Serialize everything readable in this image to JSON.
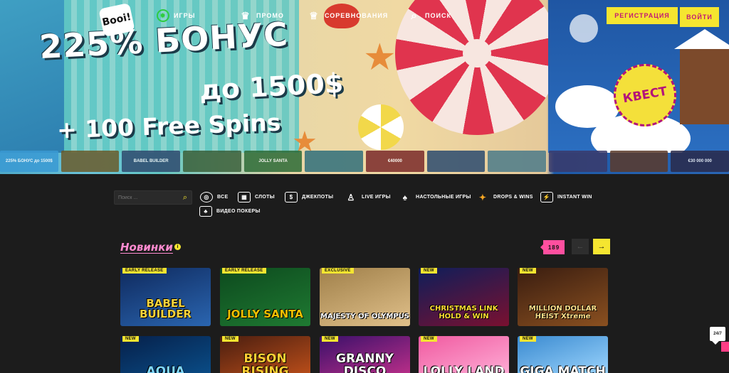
{
  "nav": {
    "logo_text": "Booi!",
    "items": [
      {
        "label": "ИГРЫ",
        "icon": "slots-coin-icon"
      },
      {
        "label": "ПРОМО",
        "icon": "crown-icon"
      },
      {
        "label": "СОРЕВНОВАНИЯ",
        "icon": "trophy-icon"
      },
      {
        "label": "ПОИСК",
        "icon": "search-icon"
      }
    ],
    "register_label": "РЕГИСТРАЦИЯ",
    "login_label": "ВОЙТИ"
  },
  "hero": {
    "line1": "225% БОНУС",
    "line2": "до 1500$",
    "line3": "+ 100 Free Spins",
    "quest_badge": "КВЕСТ"
  },
  "strip": [
    {
      "label": "225% БОНУС до 1500$",
      "color": "#3a9ad4"
    },
    {
      "label": "",
      "color": "#6a5a2a"
    },
    {
      "label": "BABEL BUILDER",
      "color": "#2f4a6e"
    },
    {
      "label": "",
      "color": "#3a5f3a"
    },
    {
      "label": "JOLLY SANTA",
      "color": "#2d6b37"
    },
    {
      "label": "",
      "color": "#2f6e7a"
    },
    {
      "label": "€40000",
      "color": "#7a2a2a"
    },
    {
      "label": "",
      "color": "#2a4a6e"
    },
    {
      "label": "",
      "color": "#4a7a8a"
    },
    {
      "label": "",
      "color": "#3a3a6a"
    },
    {
      "label": "",
      "color": "#5a3a2a"
    },
    {
      "label": "€30 000 000",
      "color": "#2a2a4a"
    }
  ],
  "filters": {
    "search_placeholder": "Поиск ...",
    "categories": [
      {
        "label": "ВСЕ",
        "icon": "all-games-icon"
      },
      {
        "label": "СЛОТЫ",
        "icon": "slot-machine-icon"
      },
      {
        "label": "ДЖЕКПОТЫ",
        "icon": "jackpot-icon"
      },
      {
        "label": "LIVE ИГРЫ",
        "icon": "live-dealer-icon"
      },
      {
        "label": "НАСТОЛЬНЫЕ ИГРЫ",
        "icon": "table-games-icon"
      },
      {
        "label": "DROPS & WINS",
        "icon": "drops-wins-icon"
      },
      {
        "label": "INSTANT WIN",
        "icon": "instant-win-icon"
      },
      {
        "label": "ВИДЕО ПОКЕРЫ",
        "icon": "video-poker-icon"
      }
    ]
  },
  "section": {
    "title": "Новинки",
    "info": "i",
    "count": "189",
    "prev": "←",
    "next": "→"
  },
  "games": [
    {
      "badge": "EARLY RELEASE",
      "name": "BABEL BUILDER",
      "color1": "#0f2a5e",
      "color2": "#2a65b0",
      "text_color": "#f5d33b"
    },
    {
      "badge": "EARLY RELEASE",
      "name": "JOLLY SANTA",
      "color1": "#0d4a1e",
      "color2": "#1f7a32",
      "text_color": "#f0c000"
    },
    {
      "badge": "EXCLUSIVE",
      "name": "MAJESTY OF OLYMPUS",
      "color1": "#a0804a",
      "color2": "#e0c08a",
      "text_color": "#ffffff"
    },
    {
      "badge": "NEW",
      "name": "CHRISTMAS LINK HOLD & WIN",
      "color1": "#0e1e5a",
      "color2": "#7a1030",
      "text_color": "#ffdd33"
    },
    {
      "badge": "NEW",
      "name": "MILLION DOLLAR HEIST Xtreme",
      "color1": "#3a1d10",
      "color2": "#8a5020",
      "text_color": "#ffe08a"
    },
    {
      "badge": "NEW",
      "name": "AQUA",
      "color1": "#06204a",
      "color2": "#0a4f8a",
      "text_color": "#7fd8ff"
    },
    {
      "badge": "NEW",
      "name": "BISON RISING",
      "color1": "#4a1e10",
      "color2": "#c0501a",
      "text_color": "#ffcf33"
    },
    {
      "badge": "NEW",
      "name": "GRANNY DISCO",
      "color1": "#3a106a",
      "color2": "#c0308a",
      "text_color": "#ffffff"
    },
    {
      "badge": "NEW",
      "name": "LOLLY LAND",
      "color1": "#f05aa0",
      "color2": "#ffb0d8",
      "text_color": "#ffffff"
    },
    {
      "badge": "NEW",
      "name": "GIGA MATCH",
      "color1": "#3a8ad0",
      "color2": "#a0d8ff",
      "text_color": "#ffffff"
    }
  ],
  "chat": {
    "label": "24/7"
  }
}
